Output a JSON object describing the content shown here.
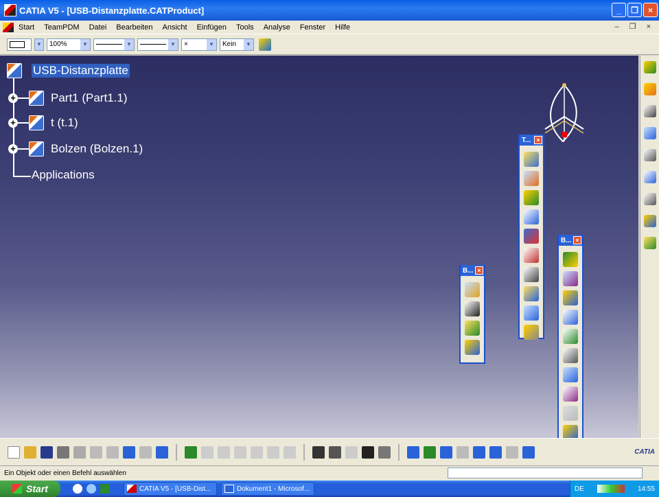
{
  "window": {
    "title": "CATIA V5 - [USB-Distanzplatte.CATProduct]"
  },
  "menu": [
    "Start",
    "TeamPDM",
    "Datei",
    "Bearbeiten",
    "Ansicht",
    "Einfügen",
    "Tools",
    "Analyse",
    "Fenster",
    "Hilfe"
  ],
  "toolbar": {
    "zoom": "100%",
    "layer": "Kein",
    "linetype": "×"
  },
  "tree": {
    "root": "USB-Distanzplatte",
    "children": [
      "Part1 (Part1.1)",
      "t (t.1)",
      "Bolzen (Bolzen.1)"
    ],
    "applications": "Applications"
  },
  "panels": {
    "t": "T...",
    "b1": "B...",
    "b2": "B...",
    "close": "×"
  },
  "status": {
    "message": "Ein Objekt oder einen Befehl auswählen"
  },
  "taskbar": {
    "start": "Start",
    "items": [
      "CATIA V5 - [USB-Dist...",
      "Dokument1 - Microsof..."
    ],
    "lang": "DE",
    "time": "14:55"
  },
  "logo": "CATIA"
}
